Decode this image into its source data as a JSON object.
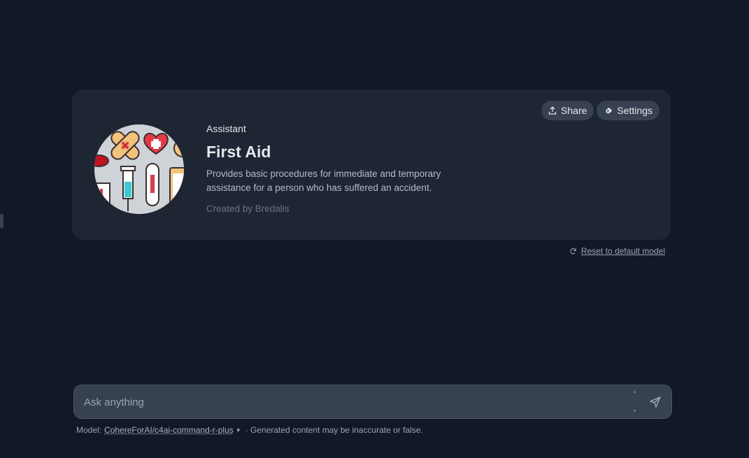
{
  "assistant": {
    "kind_label": "Assistant",
    "name": "First Aid",
    "description": "Provides basic procedures for immediate and temporary assistance for a person who has suffered an accident.",
    "creator": "Created by Bredalis",
    "avatar_icon": "first-aid-illustration"
  },
  "actions": {
    "share_label": "Share",
    "share_icon": "share-upload-icon",
    "settings_label": "Settings",
    "settings_icon": "gear-icon"
  },
  "reset": {
    "label": "Reset to default model",
    "icon": "refresh-icon"
  },
  "composer": {
    "placeholder": "Ask anything",
    "send_icon": "send-icon"
  },
  "footer": {
    "model_prefix": "Model:",
    "model_name": "CohereForAI/c4ai-command-r-plus",
    "disclaimer": "· Generated content may be inaccurate or false."
  },
  "colors": {
    "background": "#111827",
    "card": "#1e2533",
    "pill": "#374151",
    "composer": "#374151"
  }
}
